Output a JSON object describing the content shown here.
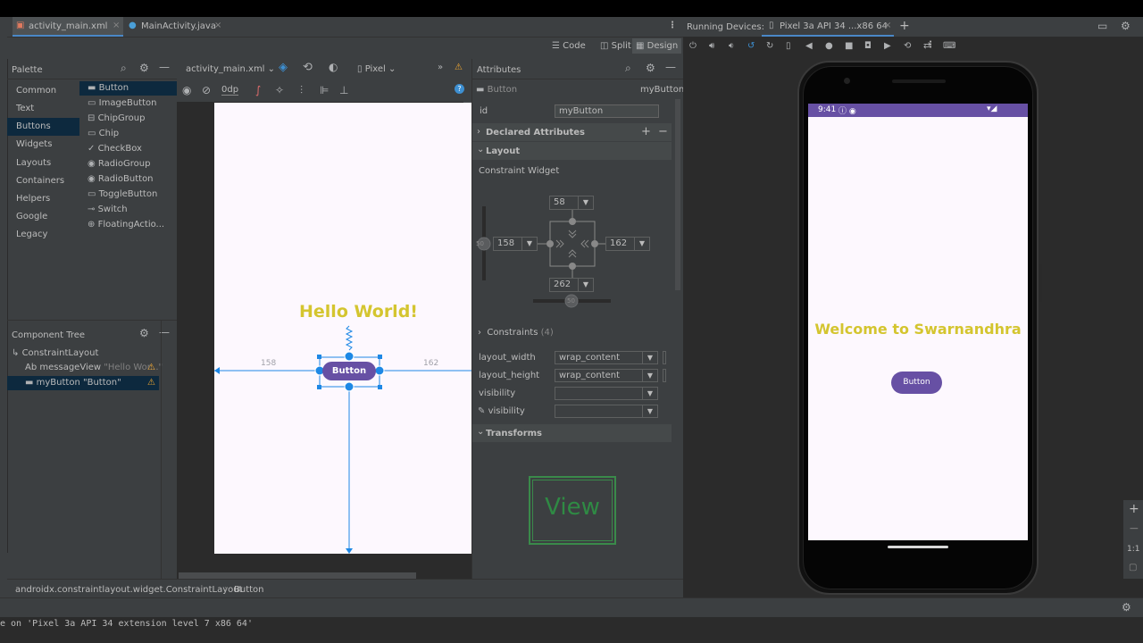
{
  "tabs": [
    {
      "label": "activity_main.xml",
      "active": true
    },
    {
      "label": "MainActivity.java",
      "active": false
    }
  ],
  "view_modes": {
    "code": "Code",
    "split": "Split",
    "design": "Design"
  },
  "palette": {
    "title": "Palette",
    "categories": [
      "Common",
      "Text",
      "Buttons",
      "Widgets",
      "Layouts",
      "Containers",
      "Helpers",
      "Google",
      "Legacy"
    ],
    "selected_category": "Buttons",
    "items": [
      "Button",
      "ImageButton",
      "ChipGroup",
      "Chip",
      "CheckBox",
      "RadioGroup",
      "RadioButton",
      "ToggleButton",
      "Switch",
      "FloatingActio..."
    ]
  },
  "design_toolbar": {
    "file": "activity_main.xml",
    "device": "Pixel",
    "margin": "0dp"
  },
  "canvas": {
    "text": "Hello World!",
    "button_label": "Button",
    "left_margin": "158",
    "right_margin": "162"
  },
  "component_tree": {
    "title": "Component Tree",
    "root": "ConstraintLayout",
    "children": [
      {
        "prefix": "Ab",
        "label": "messageView",
        "hint": "\"Hello Wor...\"",
        "warning": true
      },
      {
        "prefix": "",
        "label": "myButton",
        "hint": "\"Button\"",
        "warning": true
      }
    ]
  },
  "breadcrumb": {
    "path": "androidx.constraintlayout.widget.ConstraintLayout",
    "leaf": "Button"
  },
  "attributes": {
    "title": "Attributes",
    "widget_type": "Button",
    "widget_id": "myButton",
    "id_label": "id",
    "id_value": "myButton",
    "declared_attributes": "Declared Attributes",
    "layout_section": "Layout",
    "constraint_widget": "Constraint Widget",
    "margin_top": "58",
    "margin_left": "158",
    "margin_right": "162",
    "margin_bottom": "262",
    "bias_value": "50",
    "constraints_label": "Constraints",
    "constraints_count": "(4)",
    "rows": [
      {
        "label": "layout_width",
        "value": "wrap_content"
      },
      {
        "label": "layout_height",
        "value": "wrap_content"
      },
      {
        "label": "visibility",
        "value": ""
      },
      {
        "label": "visibility",
        "value": ""
      }
    ],
    "transforms": "Transforms",
    "view_preview": "View"
  },
  "running_devices": {
    "title": "Running Devices:",
    "device_tab": "Pixel 3a API 34 ...x86 64"
  },
  "phone": {
    "time": "9:41",
    "welcome": "Welcome to Swarnandhra",
    "button_label": "Button"
  },
  "zoom": {
    "fit": "1:1"
  },
  "status_line": "e on 'Pixel 3a API 34 extension level 7 x86 64'",
  "colors": {
    "accent_yellow": "#d4c52f",
    "button_purple": "#6750a4",
    "blueprint_blue": "#1e88e5",
    "ide_panel": "#3c3f41"
  }
}
